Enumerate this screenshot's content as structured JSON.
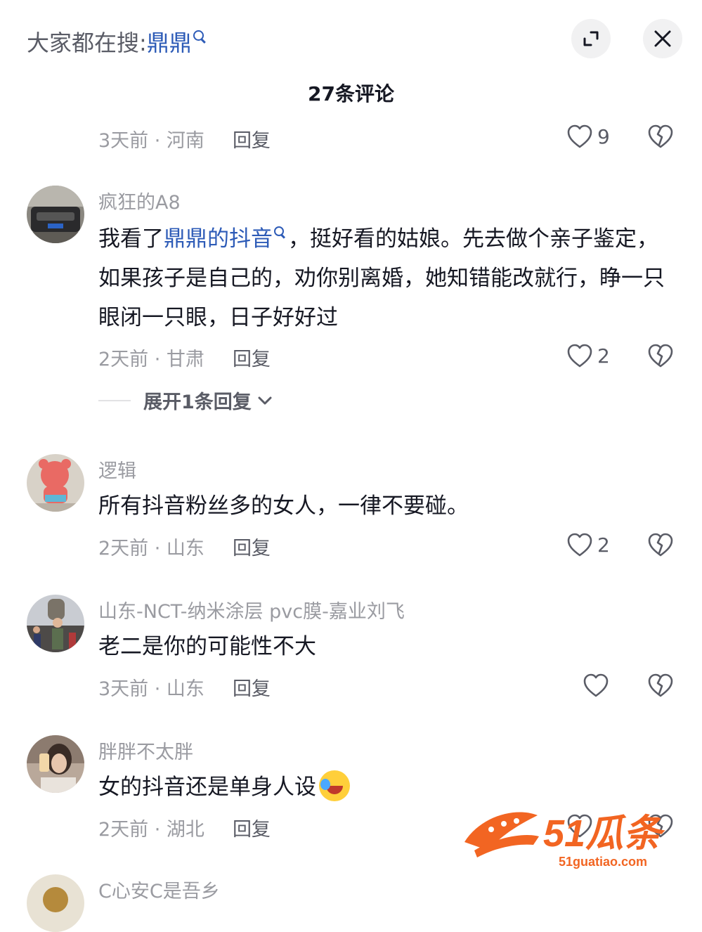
{
  "header": {
    "search_prefix": "大家都在搜:",
    "search_keyword": "鼎鼎",
    "comment_count": "27条评论"
  },
  "prev_comment_meta": {
    "time_location": "3天前 · 河南",
    "reply": "回复",
    "likes": "9"
  },
  "comments": [
    {
      "username": "疯狂的A8",
      "text_before_link": "我看了",
      "link": "鼎鼎的抖音",
      "text_after_link": "，挺好看的姑娘。先去做个亲子鉴定，如果孩子是自己的，劝你别离婚，她知错能改就行，睁一只眼闭一只眼，日子好好过",
      "time_location": "2天前 · 甘肃",
      "reply": "回复",
      "likes": "2",
      "expand": "展开1条回复"
    },
    {
      "username": "逻辑",
      "text": "所有抖音粉丝多的女人，一律不要碰。",
      "time_location": "2天前 · 山东",
      "reply": "回复",
      "likes": "2"
    },
    {
      "username": "山东-NCT-纳米涂层 pvc膜-嘉业刘飞",
      "text": "老二是你的可能性不大",
      "time_location": "3天前 · 山东",
      "reply": "回复",
      "likes": ""
    },
    {
      "username": "胖胖不太胖",
      "text": "女的抖音还是单身人设",
      "time_location": "2天前 · 湖北",
      "reply": "回复",
      "likes": ""
    },
    {
      "username": "C心安C是吾乡"
    }
  ],
  "watermark": {
    "brand": "51瓜条",
    "url": "51guatiao.com"
  },
  "colors": {
    "link": "#2d5bb7",
    "watermark": "#f26522",
    "meta": "#9a9ba1"
  },
  "icons": [
    "expand-icon",
    "close-icon",
    "heart-icon",
    "broken-heart-icon",
    "chevron-down-icon",
    "search-icon"
  ]
}
